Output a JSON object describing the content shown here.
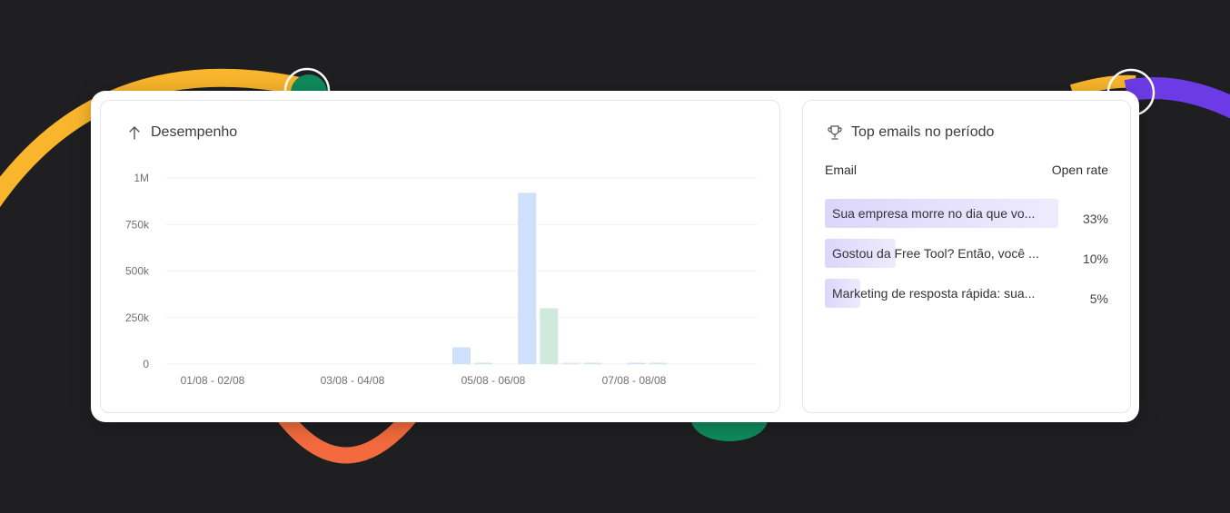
{
  "performance": {
    "title": "Desempenho",
    "icon": "arrow-up-icon"
  },
  "chart_data": {
    "type": "bar",
    "title": "Desempenho",
    "xlabel": "",
    "ylabel": "",
    "ylim": [
      0,
      1000000
    ],
    "y_ticks": [
      {
        "value": 0,
        "label": "0"
      },
      {
        "value": 250000,
        "label": "250k"
      },
      {
        "value": 500000,
        "label": "500k"
      },
      {
        "value": 750000,
        "label": "750k"
      },
      {
        "value": 1000000,
        "label": "1M"
      }
    ],
    "x_tick_labels": [
      "01/08 - 02/08",
      "03/08 - 04/08",
      "05/08 - 06/08",
      "07/08 - 08/08"
    ],
    "series": [
      {
        "color": "#cfe0fb",
        "values": [
          0,
          0,
          0,
          0,
          0,
          0,
          0,
          0,
          0,
          0,
          0,
          0,
          0,
          90000,
          0,
          0,
          920000,
          0,
          0,
          0,
          0,
          5000,
          0,
          0,
          0,
          0,
          0
        ]
      },
      {
        "color": "#cfe9dd",
        "values": [
          0,
          0,
          0,
          0,
          0,
          0,
          0,
          0,
          0,
          0,
          0,
          0,
          0,
          0,
          4000,
          0,
          0,
          300000,
          0,
          6000,
          0,
          0,
          3000,
          0,
          0,
          0,
          0
        ]
      },
      {
        "color": "#e1e4ea",
        "values": [
          0,
          0,
          0,
          0,
          0,
          0,
          0,
          0,
          0,
          0,
          0,
          0,
          0,
          0,
          0,
          0,
          0,
          0,
          7000,
          0,
          0,
          0,
          0,
          0,
          0,
          0,
          0
        ]
      }
    ],
    "grid": true,
    "legend": "none"
  },
  "top_emails": {
    "title": "Top emails no período",
    "icon": "trophy-icon",
    "col_email": "Email",
    "col_rate": "Open rate",
    "rows": [
      {
        "subject": "Sua empresa morre no dia que vo...",
        "rate": "33%",
        "fraction": 1.0
      },
      {
        "subject": "Gostou da Free Tool? Então, você ...",
        "rate": "10%",
        "fraction": 0.303
      },
      {
        "subject": "Marketing de resposta rápida: sua...",
        "rate": "5%",
        "fraction": 0.152
      }
    ]
  },
  "colors": {
    "background": "#1f1e21",
    "accent_yellow": "#f9b52c",
    "accent_orange": "#f26a3d",
    "accent_green": "#0f8a5b",
    "accent_purple": "#6c3be6"
  }
}
